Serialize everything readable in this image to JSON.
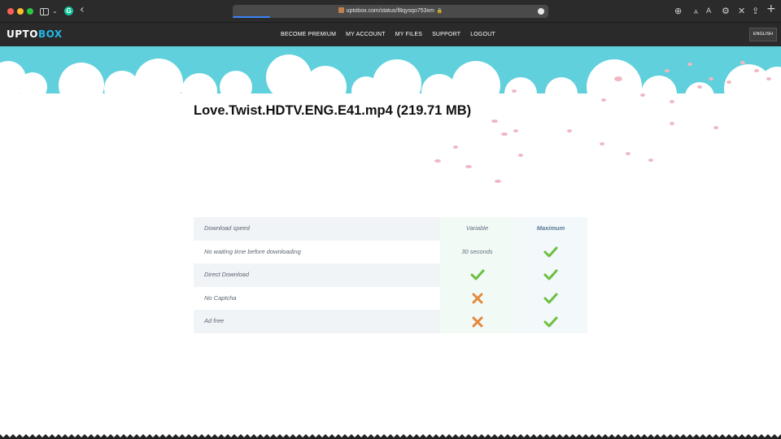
{
  "browser": {
    "url": "uptobox.com/status/f8qysqo753xm",
    "reader_small": "A",
    "reader_large": "A"
  },
  "navbar": {
    "logo_part1": "UPTO",
    "logo_part2": "BOX",
    "links": [
      "BECOME PREMIUM",
      "MY ACCOUNT",
      "MY FILES",
      "SUPPORT",
      "LOGOUT"
    ],
    "language": "ENGLISH"
  },
  "file": {
    "title": "Love.Twist.HDTV.ENG.E41.mp4 (219.71 MB)"
  },
  "comparison": {
    "rows": [
      {
        "feature": "Download speed",
        "free": "Variable",
        "premium": "Maximum"
      },
      {
        "feature": "No waiting time before downloading",
        "free": "30 seconds",
        "premium": "check-icon"
      },
      {
        "feature": "Direct Download",
        "free": "check-icon",
        "premium": "check-icon"
      },
      {
        "feature": "No Captcha",
        "free": "cross-icon",
        "premium": "check-icon"
      },
      {
        "feature": "Ad free",
        "free": "cross-icon",
        "premium": "check-icon"
      }
    ]
  },
  "colors": {
    "sky": "#5fd0dc",
    "check": "#6cbf3f",
    "cross": "#e4883a",
    "logo_accent": "#22b8e8"
  }
}
